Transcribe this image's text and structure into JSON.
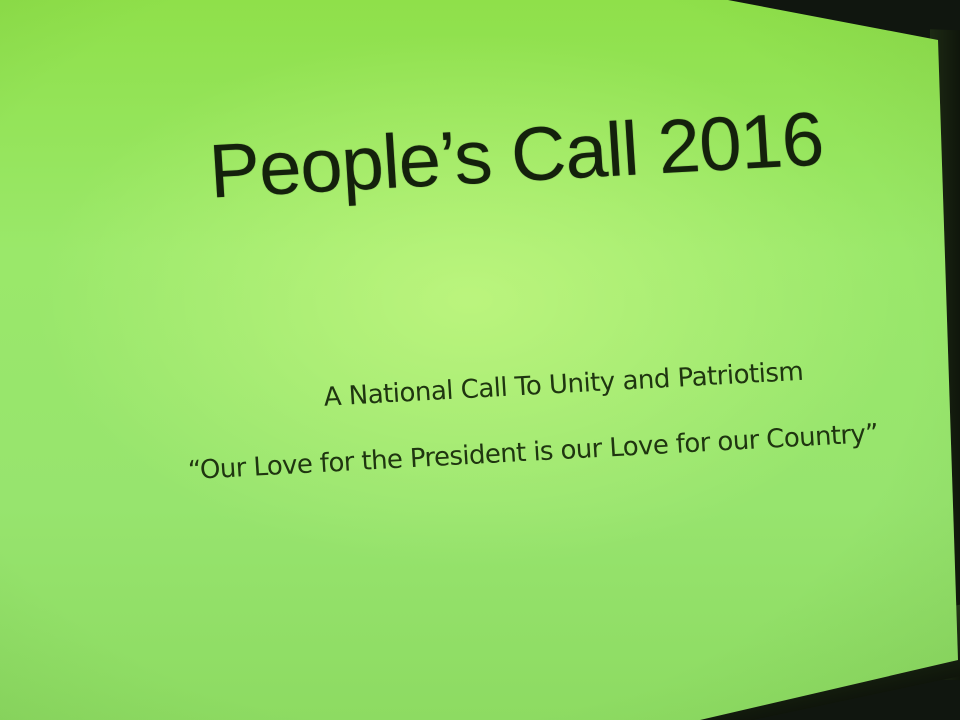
{
  "slide": {
    "title": "People’s Call 2016",
    "subtitle": "A National Call To Unity and Patriotism",
    "quote": "“Our Love for the President is our Love for our Country”"
  },
  "colors": {
    "slide_background": "#97e46e",
    "text": "#1f3510",
    "frame": "#10160f"
  }
}
